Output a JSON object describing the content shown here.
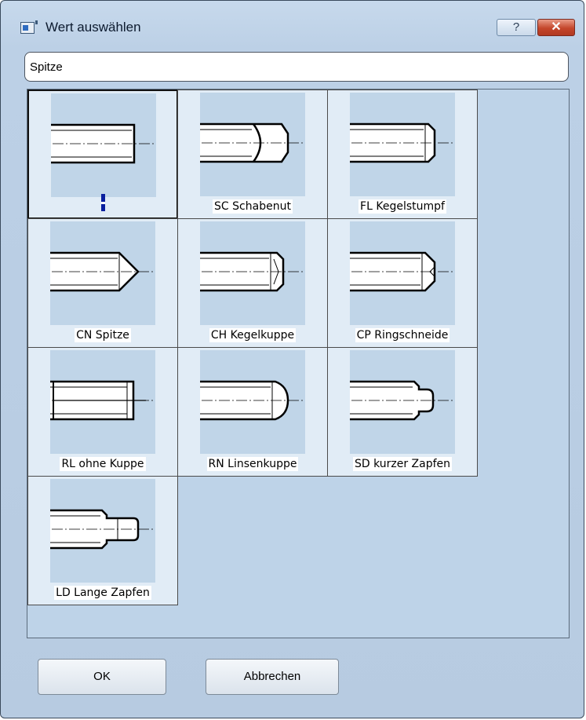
{
  "window": {
    "title": "Wert auswählen",
    "help_label": "?",
    "close_label": "✕"
  },
  "search": {
    "value": "Spitze",
    "icon": "window-icon"
  },
  "items": [
    {
      "id": "none",
      "label": "",
      "shape": "none"
    },
    {
      "id": "sc",
      "label": "SC Schabenut",
      "shape": "scraping-groove"
    },
    {
      "id": "fl",
      "label": "FL Kegelstumpf",
      "shape": "flat-chamfer"
    },
    {
      "id": "cn",
      "label": "CN Spitze",
      "shape": "cone-point"
    },
    {
      "id": "ch",
      "label": "CH Kegelkuppe",
      "shape": "cone-chamfer"
    },
    {
      "id": "cp",
      "label": "CP Ringschneide",
      "shape": "cup-point"
    },
    {
      "id": "rl",
      "label": "RL ohne Kuppe",
      "shape": "plain"
    },
    {
      "id": "rn",
      "label": "RN Linsenkuppe",
      "shape": "rounded"
    },
    {
      "id": "sd",
      "label": "SD kurzer Zapfen",
      "shape": "short-dog"
    },
    {
      "id": "ld",
      "label": "LD Lange Zapfen",
      "shape": "long-dog"
    }
  ],
  "buttons": {
    "ok": "OK",
    "cancel": "Abbrechen"
  }
}
